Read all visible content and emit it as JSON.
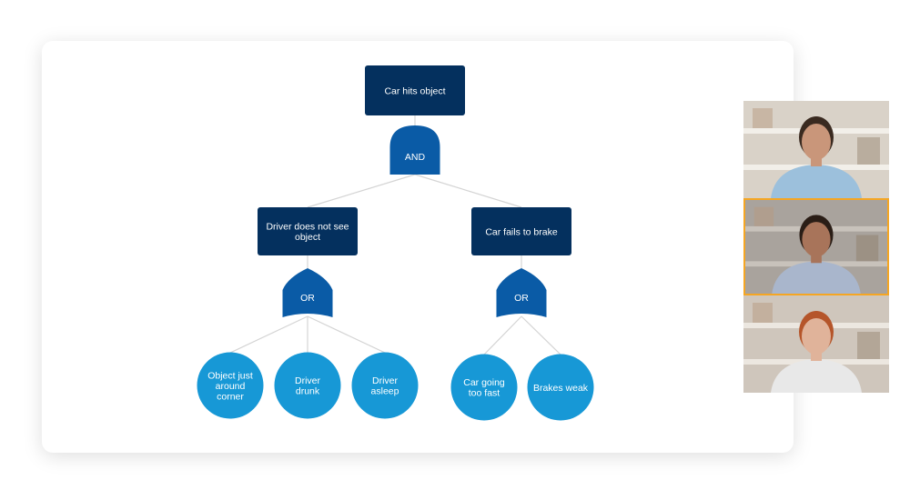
{
  "diagram": {
    "root": {
      "label": "Car hits object"
    },
    "root_gate": {
      "label": "AND",
      "type": "and"
    },
    "events": [
      {
        "label": "Driver does not see object"
      },
      {
        "label": "Car fails to brake"
      }
    ],
    "gates": [
      {
        "label": "OR",
        "type": "or"
      },
      {
        "label": "OR",
        "type": "or"
      }
    ],
    "leaves": [
      {
        "label": "Object just around corner",
        "parent": 0
      },
      {
        "label": "Driver drunk",
        "parent": 0
      },
      {
        "label": "Driver asleep",
        "parent": 0
      },
      {
        "label": "Car going too fast",
        "parent": 1
      },
      {
        "label": "Brakes weak",
        "parent": 1
      }
    ],
    "colors": {
      "event_box": "#04305e",
      "gate": "#0a5ba6",
      "leaf": "#1798d6",
      "connector": "#d4d4d4"
    }
  },
  "video_call": {
    "participants": [
      {
        "active": false
      },
      {
        "active": true
      },
      {
        "active": false
      }
    ],
    "active_border_color": "#f5a623"
  }
}
